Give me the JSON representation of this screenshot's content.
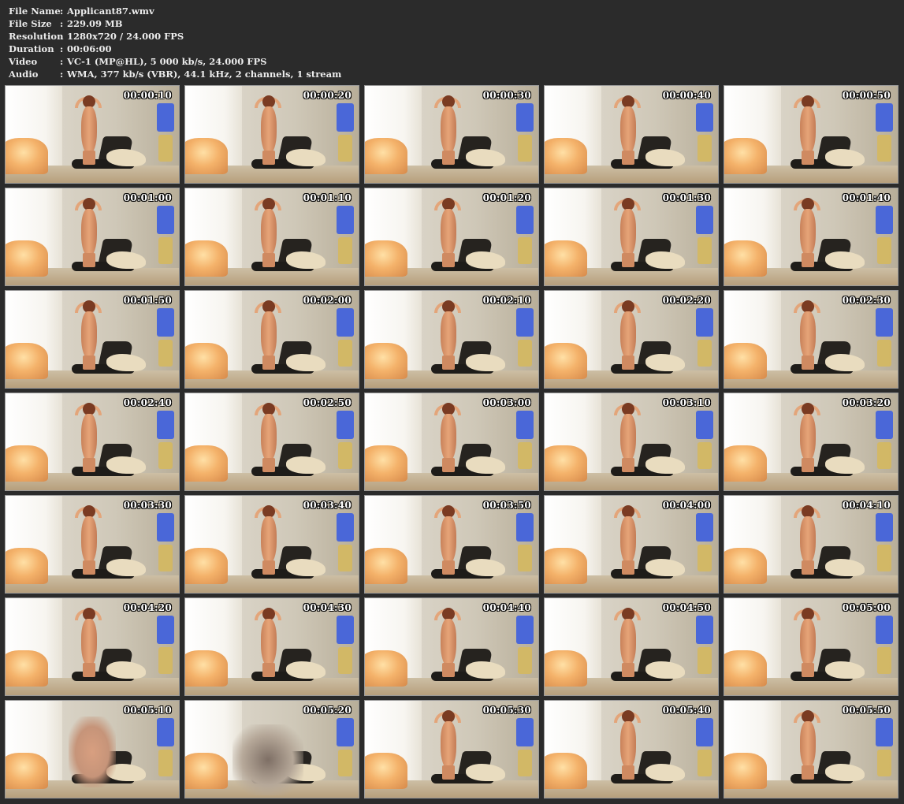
{
  "info": {
    "rows": [
      {
        "key": "File Name",
        "sep": ":",
        "value": "Applicant87.wmv"
      },
      {
        "key": "File Size",
        "sep": ":",
        "value": "229.09 MB"
      },
      {
        "key": "Resolution",
        "sep": ":",
        "value": "1280x720 / 24.000 FPS"
      },
      {
        "key": "Duration",
        "sep": ":",
        "value": "00:06:00"
      },
      {
        "key": "Video",
        "sep": ":",
        "value": "VC-1 (MP@HL), 5 000 kb/s, 24.000 FPS"
      },
      {
        "key": "Audio",
        "sep": ":",
        "value": "WMA, 377 kb/s (VBR), 44.1 kHz, 2 channels, 1 stream"
      }
    ]
  },
  "thumbnails": [
    "00:00:10",
    "00:00:20",
    "00:00:30",
    "00:00:40",
    "00:00:50",
    "00:01:00",
    "00:01:10",
    "00:01:20",
    "00:01:30",
    "00:01:40",
    "00:01:50",
    "00:02:00",
    "00:02:10",
    "00:02:20",
    "00:02:30",
    "00:02:40",
    "00:02:50",
    "00:03:00",
    "00:03:10",
    "00:03:20",
    "00:03:30",
    "00:03:40",
    "00:03:50",
    "00:04:00",
    "00:04:10",
    "00:04:20",
    "00:04:30",
    "00:04:40",
    "00:04:50",
    "00:05:00",
    "00:05:10",
    "00:05:20",
    "00:05:30",
    "00:05:40",
    "00:05:50"
  ]
}
